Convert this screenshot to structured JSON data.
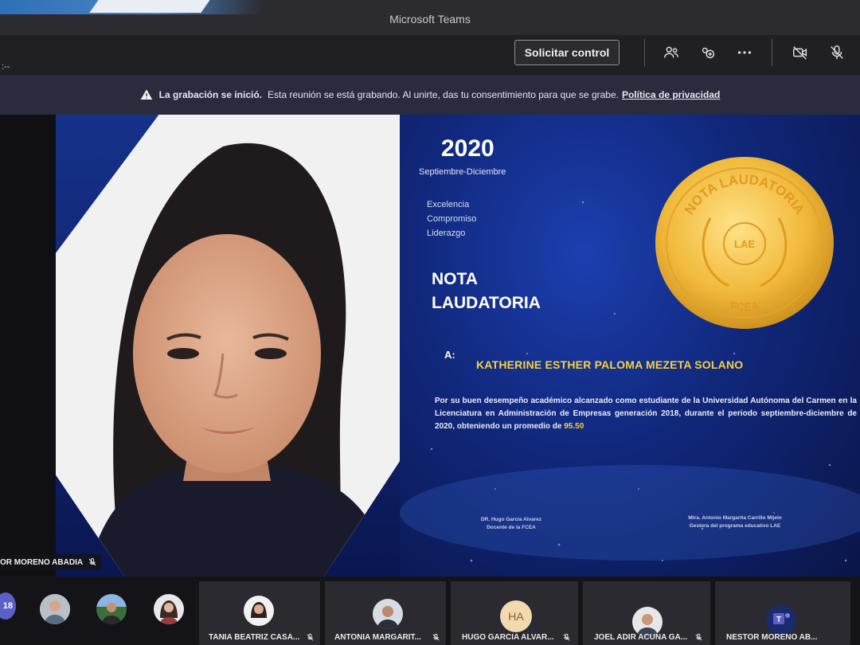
{
  "app": {
    "title": "Microsoft Teams",
    "timer": ":--"
  },
  "toolbar": {
    "request_control": "Solicitar control",
    "icons": [
      "people-icon",
      "share-tray-icon",
      "more-icon",
      "camera-off-icon",
      "mic-off-icon"
    ]
  },
  "banner": {
    "label": "La grabación se inició.",
    "text": "Esta reunión se está grabando. Al unirte, das tu consentimiento para que se grabe.",
    "link": "Política de privacidad"
  },
  "speaker": {
    "name": "OR MORENO ABADIA"
  },
  "certificate": {
    "year": "2020",
    "period": "Septiembre-Diciembre",
    "values": [
      "Excelencia",
      "Compromiso",
      "Liderazgo"
    ],
    "heading_line1": "NOTA",
    "heading_line2": "LAUDATORIA",
    "to": "A:",
    "recipient": "KATHERINE ESTHER PALOMA MEZETA SOLANO",
    "body": "Por su buen desempeño académico alcanzado como estudiante de la Universidad Autónoma del Carmen en la Licenciatura en Administración de Empresas generación 2018, durante el periodo septiembre-diciembre de 2020, obteniendo un promedio de",
    "grade": "95.50",
    "seal": {
      "top": "NOTA LAUDATORIA",
      "center": "LAE",
      "bottom": "FCEA"
    },
    "signature_left": {
      "name": "DR. Hugo Garcia Alvarez",
      "role": "Docente de la FCEA"
    },
    "signature_right": {
      "name": "Mtra. Antonio Margarita Carrillo Mijein",
      "role": "Gestora del programa educativo LAE"
    }
  },
  "participants": {
    "overflow_count": "18",
    "tiles": [
      {
        "name": "TANIA BEATRIZ CASA..."
      },
      {
        "name": "ANTONIA MARGARIT..."
      },
      {
        "name": "HUGO GARCIA ALVAR...",
        "initials": "HA"
      },
      {
        "name": "JOEL ADIR ACUNA GA..."
      },
      {
        "name": "NESTOR MORENO AB..."
      }
    ]
  },
  "colors": {
    "accent": "#5b5fc7",
    "gold": "#f6d23a",
    "banner_bg": "#2a2c3e",
    "cert_blue": "#10277a"
  }
}
